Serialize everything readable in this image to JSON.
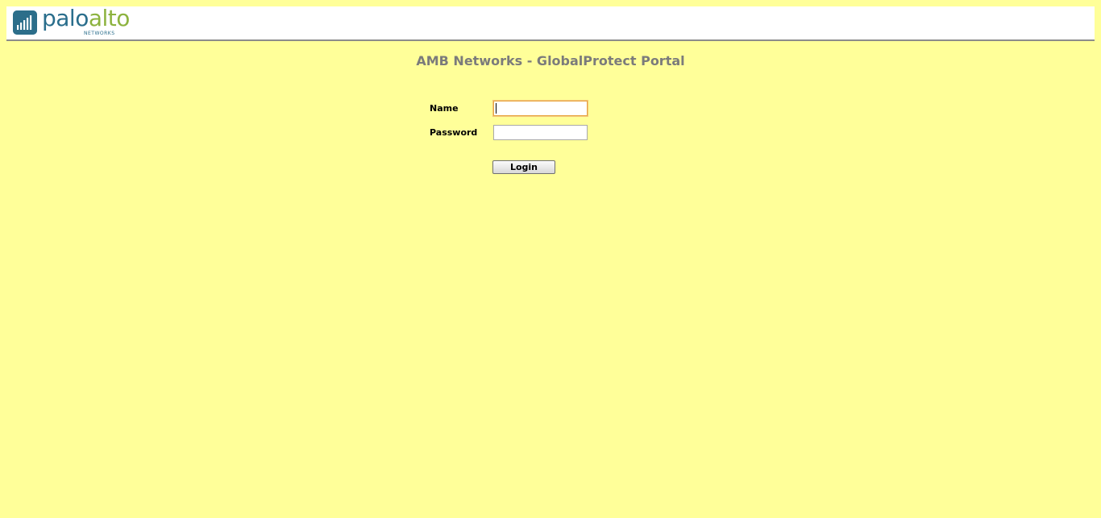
{
  "header": {
    "logo": {
      "brand_primary": "palo",
      "brand_secondary": "alto",
      "brand_sub": "NETWORKS",
      "icon": "palo-alto-networks-logo-icon",
      "primary_color": "#2a6e8c",
      "secondary_color": "#8db33f"
    }
  },
  "portal": {
    "title": "AMB Networks - GlobalProtect Portal"
  },
  "form": {
    "name_label": "Name",
    "name_value": "",
    "password_label": "Password",
    "password_value": "",
    "login_label": "Login"
  },
  "colors": {
    "background": "#ffff99",
    "header_background": "#ffffff",
    "title_text": "#7b7b7b",
    "focus_border": "#e8a640"
  }
}
